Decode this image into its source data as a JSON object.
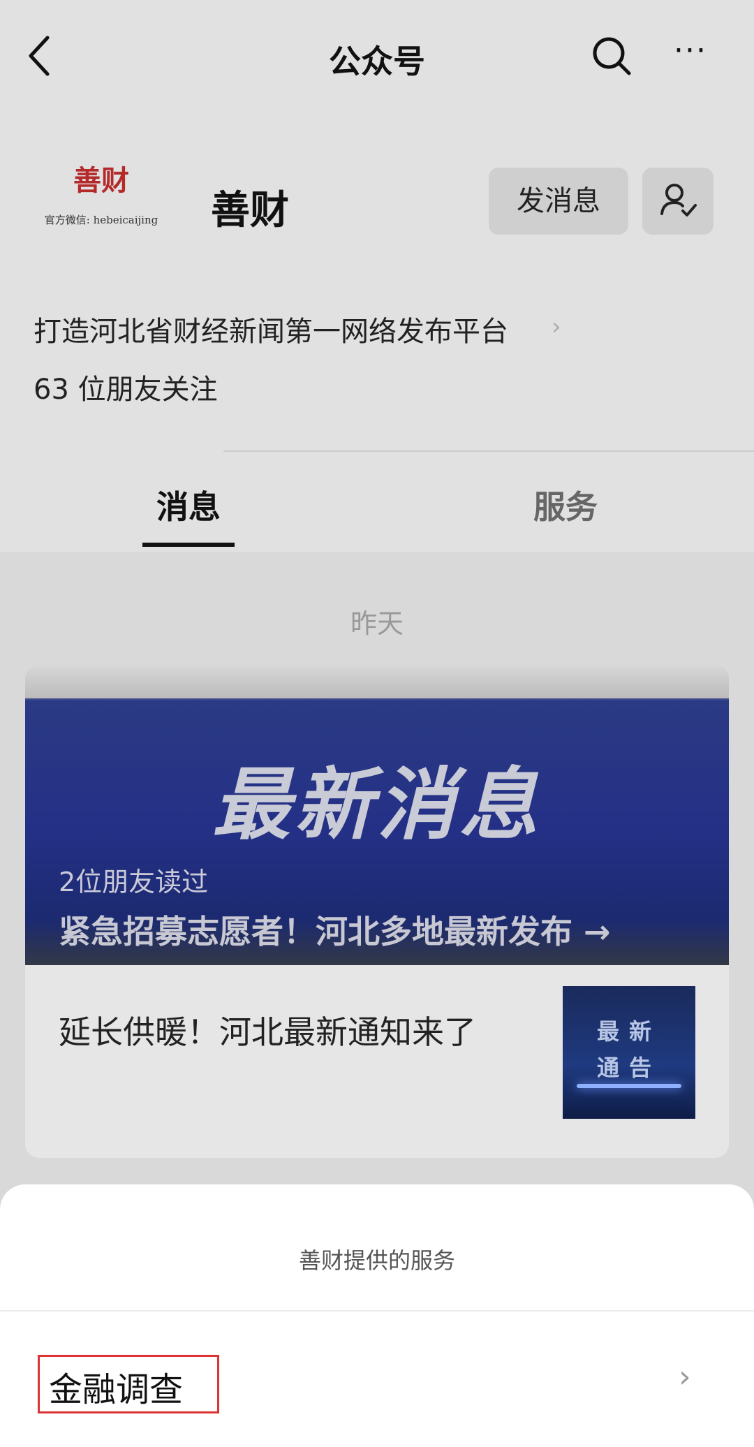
{
  "header": {
    "title": "公众号",
    "back_icon": "back-icon",
    "search_icon": "search-icon",
    "more_icon": "more-icon",
    "more_label": "···"
  },
  "profile": {
    "logo_text": "善财",
    "logo_sub": "官方微信: hebeicaijing",
    "name": "善财",
    "message_button": "发消息",
    "description": "打造河北省财经新闻第一网络发布平台",
    "followers": "63 位朋友关注"
  },
  "tabs": [
    {
      "label": "消息"
    },
    {
      "label": "服务"
    }
  ],
  "feed": {
    "date": "昨天",
    "banner_text": "最新消息",
    "friends_read": "2位朋友读过",
    "headline": "紧急招募志愿者！河北多地最新发布 →",
    "item_text": "延长供暖！河北最新通知来了",
    "thumb_line1": "最新",
    "thumb_line2": "通告"
  },
  "sheet": {
    "title": "善财提供的服务",
    "service_label": "金融调查",
    "service_arrow": "›"
  },
  "colors": {
    "highlight_box": "#dd3333",
    "banner_blue": "#243086"
  }
}
